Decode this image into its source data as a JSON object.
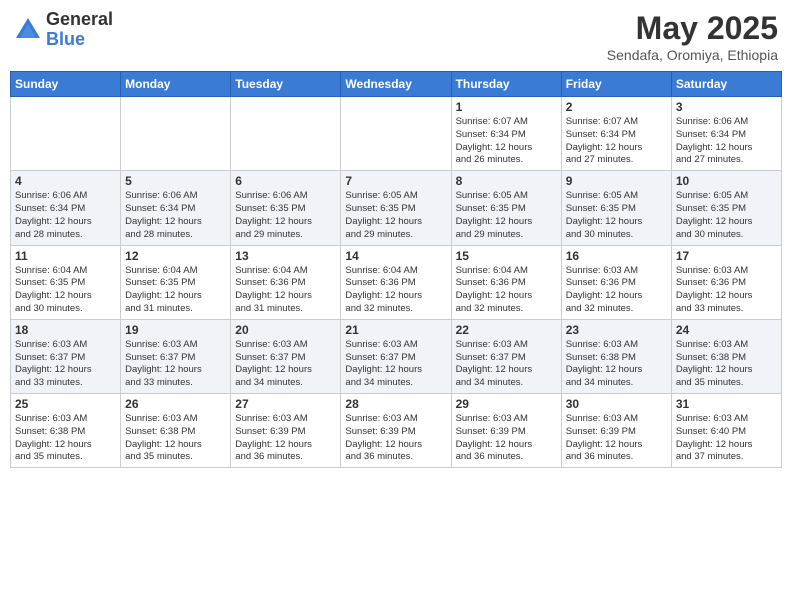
{
  "header": {
    "logo_general": "General",
    "logo_blue": "Blue",
    "month_year": "May 2025",
    "location": "Sendafa, Oromiya, Ethiopia"
  },
  "weekdays": [
    "Sunday",
    "Monday",
    "Tuesday",
    "Wednesday",
    "Thursday",
    "Friday",
    "Saturday"
  ],
  "weeks": [
    [
      {
        "day": "",
        "info": ""
      },
      {
        "day": "",
        "info": ""
      },
      {
        "day": "",
        "info": ""
      },
      {
        "day": "",
        "info": ""
      },
      {
        "day": "1",
        "info": "Sunrise: 6:07 AM\nSunset: 6:34 PM\nDaylight: 12 hours\nand 26 minutes."
      },
      {
        "day": "2",
        "info": "Sunrise: 6:07 AM\nSunset: 6:34 PM\nDaylight: 12 hours\nand 27 minutes."
      },
      {
        "day": "3",
        "info": "Sunrise: 6:06 AM\nSunset: 6:34 PM\nDaylight: 12 hours\nand 27 minutes."
      }
    ],
    [
      {
        "day": "4",
        "info": "Sunrise: 6:06 AM\nSunset: 6:34 PM\nDaylight: 12 hours\nand 28 minutes."
      },
      {
        "day": "5",
        "info": "Sunrise: 6:06 AM\nSunset: 6:34 PM\nDaylight: 12 hours\nand 28 minutes."
      },
      {
        "day": "6",
        "info": "Sunrise: 6:06 AM\nSunset: 6:35 PM\nDaylight: 12 hours\nand 29 minutes."
      },
      {
        "day": "7",
        "info": "Sunrise: 6:05 AM\nSunset: 6:35 PM\nDaylight: 12 hours\nand 29 minutes."
      },
      {
        "day": "8",
        "info": "Sunrise: 6:05 AM\nSunset: 6:35 PM\nDaylight: 12 hours\nand 29 minutes."
      },
      {
        "day": "9",
        "info": "Sunrise: 6:05 AM\nSunset: 6:35 PM\nDaylight: 12 hours\nand 30 minutes."
      },
      {
        "day": "10",
        "info": "Sunrise: 6:05 AM\nSunset: 6:35 PM\nDaylight: 12 hours\nand 30 minutes."
      }
    ],
    [
      {
        "day": "11",
        "info": "Sunrise: 6:04 AM\nSunset: 6:35 PM\nDaylight: 12 hours\nand 30 minutes."
      },
      {
        "day": "12",
        "info": "Sunrise: 6:04 AM\nSunset: 6:35 PM\nDaylight: 12 hours\nand 31 minutes."
      },
      {
        "day": "13",
        "info": "Sunrise: 6:04 AM\nSunset: 6:36 PM\nDaylight: 12 hours\nand 31 minutes."
      },
      {
        "day": "14",
        "info": "Sunrise: 6:04 AM\nSunset: 6:36 PM\nDaylight: 12 hours\nand 32 minutes."
      },
      {
        "day": "15",
        "info": "Sunrise: 6:04 AM\nSunset: 6:36 PM\nDaylight: 12 hours\nand 32 minutes."
      },
      {
        "day": "16",
        "info": "Sunrise: 6:03 AM\nSunset: 6:36 PM\nDaylight: 12 hours\nand 32 minutes."
      },
      {
        "day": "17",
        "info": "Sunrise: 6:03 AM\nSunset: 6:36 PM\nDaylight: 12 hours\nand 33 minutes."
      }
    ],
    [
      {
        "day": "18",
        "info": "Sunrise: 6:03 AM\nSunset: 6:37 PM\nDaylight: 12 hours\nand 33 minutes."
      },
      {
        "day": "19",
        "info": "Sunrise: 6:03 AM\nSunset: 6:37 PM\nDaylight: 12 hours\nand 33 minutes."
      },
      {
        "day": "20",
        "info": "Sunrise: 6:03 AM\nSunset: 6:37 PM\nDaylight: 12 hours\nand 34 minutes."
      },
      {
        "day": "21",
        "info": "Sunrise: 6:03 AM\nSunset: 6:37 PM\nDaylight: 12 hours\nand 34 minutes."
      },
      {
        "day": "22",
        "info": "Sunrise: 6:03 AM\nSunset: 6:37 PM\nDaylight: 12 hours\nand 34 minutes."
      },
      {
        "day": "23",
        "info": "Sunrise: 6:03 AM\nSunset: 6:38 PM\nDaylight: 12 hours\nand 34 minutes."
      },
      {
        "day": "24",
        "info": "Sunrise: 6:03 AM\nSunset: 6:38 PM\nDaylight: 12 hours\nand 35 minutes."
      }
    ],
    [
      {
        "day": "25",
        "info": "Sunrise: 6:03 AM\nSunset: 6:38 PM\nDaylight: 12 hours\nand 35 minutes."
      },
      {
        "day": "26",
        "info": "Sunrise: 6:03 AM\nSunset: 6:38 PM\nDaylight: 12 hours\nand 35 minutes."
      },
      {
        "day": "27",
        "info": "Sunrise: 6:03 AM\nSunset: 6:39 PM\nDaylight: 12 hours\nand 36 minutes."
      },
      {
        "day": "28",
        "info": "Sunrise: 6:03 AM\nSunset: 6:39 PM\nDaylight: 12 hours\nand 36 minutes."
      },
      {
        "day": "29",
        "info": "Sunrise: 6:03 AM\nSunset: 6:39 PM\nDaylight: 12 hours\nand 36 minutes."
      },
      {
        "day": "30",
        "info": "Sunrise: 6:03 AM\nSunset: 6:39 PM\nDaylight: 12 hours\nand 36 minutes."
      },
      {
        "day": "31",
        "info": "Sunrise: 6:03 AM\nSunset: 6:40 PM\nDaylight: 12 hours\nand 37 minutes."
      }
    ]
  ]
}
